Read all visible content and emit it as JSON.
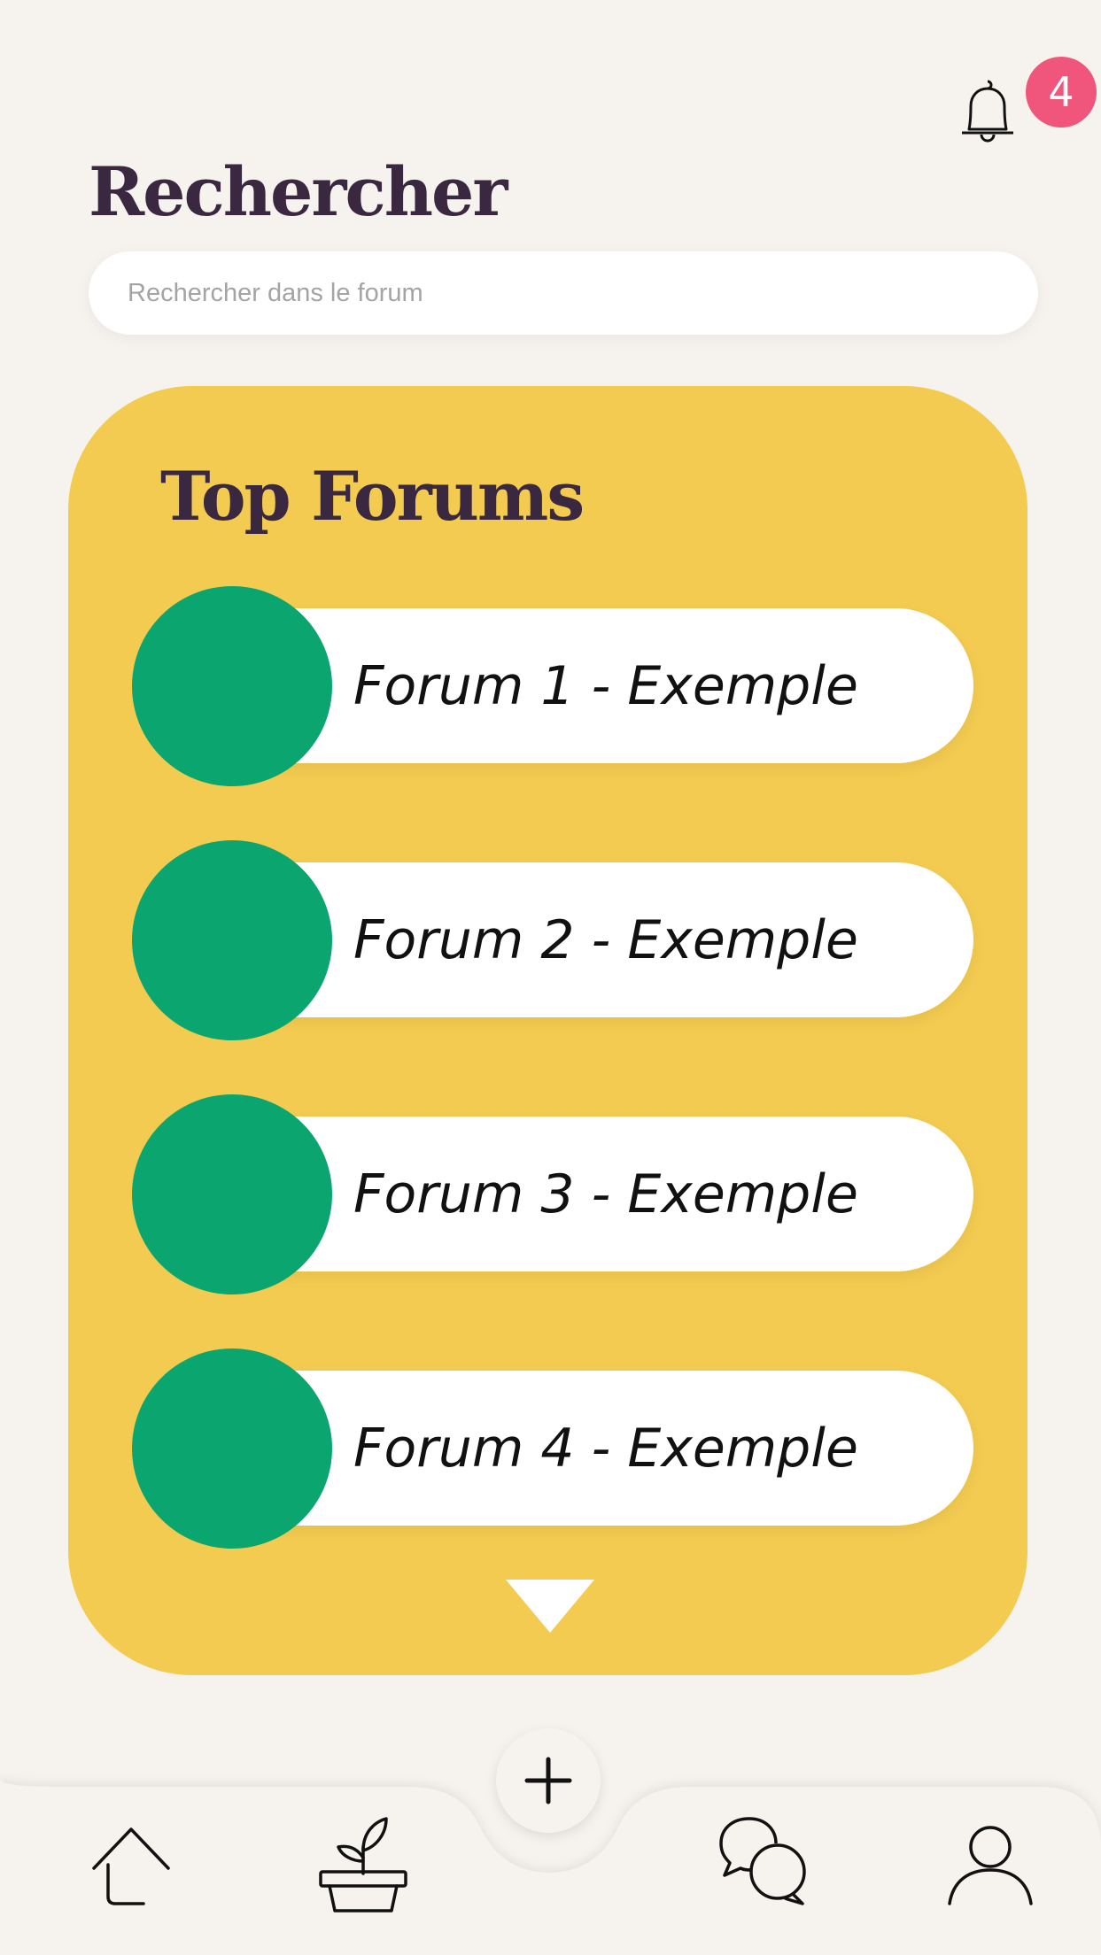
{
  "notifications": {
    "count": "4",
    "icon": "bell-icon"
  },
  "header": {
    "title": "Rechercher"
  },
  "search": {
    "placeholder": "Rechercher dans le forum",
    "value": ""
  },
  "top_forums": {
    "title": "Top Forums",
    "items": [
      {
        "label": "Forum 1 - Exemple"
      },
      {
        "label": "Forum 2 - Exemple"
      },
      {
        "label": "Forum 3 - Exemple"
      },
      {
        "label": "Forum 4 - Exemple"
      }
    ]
  },
  "bottom_nav": {
    "items": [
      {
        "icon": "home-icon"
      },
      {
        "icon": "plant-pot-icon"
      },
      {
        "icon": "add-icon"
      },
      {
        "icon": "chat-bubbles-icon"
      },
      {
        "icon": "user-icon"
      }
    ]
  },
  "colors": {
    "background": "#f6f3ee",
    "card": "#f3cb50",
    "avatar": "#0ba66f",
    "badge": "#f0567b",
    "title": "#3a2740"
  }
}
